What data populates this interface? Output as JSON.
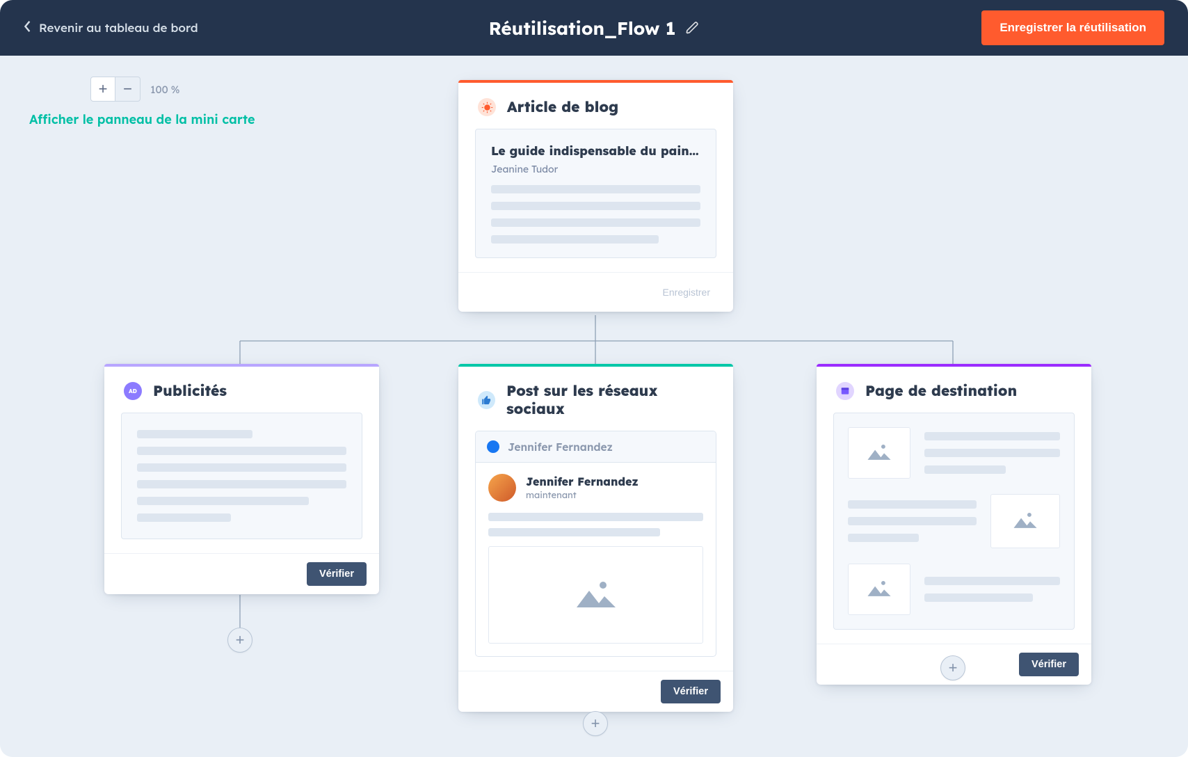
{
  "header": {
    "back_label": "Revenir au tableau de bord",
    "title": "Réutilisation_Flow 1",
    "save_label": "Enregistrer la réutilisation"
  },
  "toolbar": {
    "zoom_level": "100 %",
    "minimap_label": "Afficher le panneau de la mini carte"
  },
  "cards": {
    "blog": {
      "title": "Article de blog",
      "article_title": "Le guide indispensable du pain artis…",
      "author": "Jeanine Tudor",
      "action_label": "Enregistrer"
    },
    "ads": {
      "title": "Publicités",
      "badge_text": "AD",
      "action_label": "Vérifier"
    },
    "social": {
      "title": "Post sur les réseaux sociaux",
      "tab_name": "Jennifer Fernandez",
      "post_author": "Jennifer Fernandez",
      "post_time": "maintenant",
      "action_label": "Vérifier"
    },
    "landing": {
      "title": "Page de destination",
      "action_label": "Vérifier"
    }
  },
  "colors": {
    "header_bg": "#24344d",
    "primary_btn": "#ff5b2e",
    "teal_link": "#00bfa5",
    "accent_blog": "#ff5b2e",
    "accent_ads": "#b8a6ff",
    "accent_social": "#00c7a8",
    "accent_landing": "#9b2cff"
  }
}
